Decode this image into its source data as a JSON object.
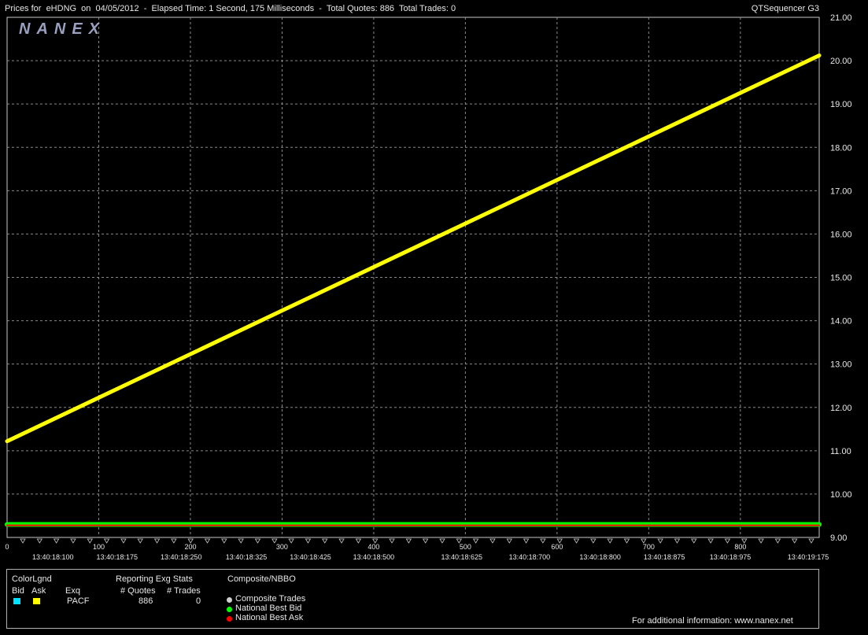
{
  "header": {
    "title": "Prices for  eHDNG  on  04/05/2012  -  Elapsed Time: 1 Second, 175 Milliseconds  -  Total Quotes: 886  Total Trades: 0",
    "app_name": "QTSequencer G3",
    "logo": "NANEX"
  },
  "chart_data": {
    "type": "line",
    "title": "",
    "xlabel": "",
    "ylabel": "",
    "xlim": [
      0,
      886
    ],
    "ylim": [
      9.0,
      21.0
    ],
    "x_ticks": [
      0,
      100,
      200,
      300,
      400,
      500,
      600,
      700,
      800
    ],
    "y_ticks": [
      "21.00",
      "20.00",
      "19.00",
      "18.00",
      "17.00",
      "16.00",
      "15.00",
      "14.00",
      "13.00",
      "12.00",
      "11.00",
      "10.00",
      "9.00"
    ],
    "time_labels": [
      {
        "x": 50,
        "label": "13:40:18:100"
      },
      {
        "x": 120,
        "label": "13:40:18:175"
      },
      {
        "x": 190,
        "label": "13:40:18:250"
      },
      {
        "x": 261,
        "label": "13:40:18:325"
      },
      {
        "x": 331,
        "label": "13:40:18:425"
      },
      {
        "x": 400,
        "label": "13:40:18:500"
      },
      {
        "x": 496,
        "label": "13:40:18:625"
      },
      {
        "x": 570,
        "label": "13:40:18:700"
      },
      {
        "x": 647,
        "label": "13:40:18:800"
      },
      {
        "x": 717,
        "label": "13:40:18:875"
      },
      {
        "x": 789,
        "label": "13:40:18:975"
      },
      {
        "x": 874,
        "label": "13:40:19:175"
      }
    ],
    "series": [
      {
        "name": "Ask",
        "color": "#ffff00",
        "x": [
          0,
          886
        ],
        "y": [
          11.22,
          20.12
        ]
      },
      {
        "name": "National Best Bid",
        "color": "#00ff00",
        "x": [
          0,
          886
        ],
        "y": [
          9.3,
          9.3
        ]
      },
      {
        "name": "National Best Ask",
        "color": "#ff0000",
        "x": [
          0,
          886
        ],
        "y": [
          9.28,
          9.28
        ]
      }
    ],
    "grid": true
  },
  "legend": {
    "color_legend_label": "ColorLgnd",
    "bid_label": "Bid",
    "ask_label": "Ask",
    "exq_label": "Exq",
    "exchange": "PACF",
    "bid_color": "#00e5ff",
    "ask_color": "#ffff00",
    "reporting_label": "Reporting Exg Stats",
    "quotes_label": "# Quotes",
    "trades_label": "# Trades",
    "quotes_value": "886",
    "trades_value": "0",
    "composite_label": "Composite/NBBO",
    "composite_trades": "Composite Trades",
    "national_best_bid": "National Best Bid",
    "national_best_ask": "National Best Ask",
    "composite_color": "#d0d0d0",
    "nbb_color": "#00ff00",
    "nba_color": "#ff0000",
    "footer": "For additional information: www.nanex.net"
  }
}
